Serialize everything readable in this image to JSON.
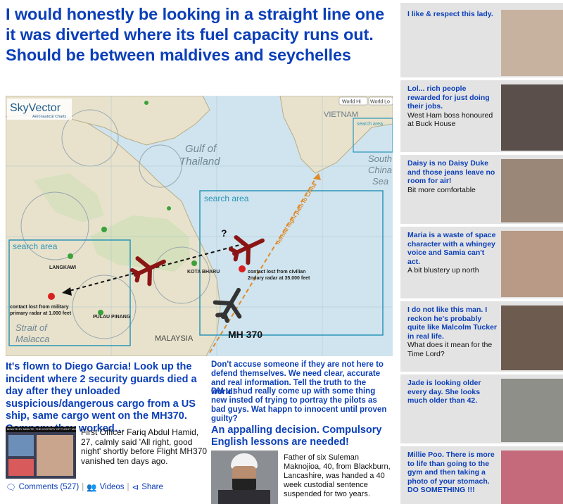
{
  "headline": "I would honestly be looking in a straight line one it was diverted where its fuel capacity runs out. Should be between maldives and seychelles",
  "map": {
    "brand": "SkyVector",
    "brand_sub": "Aeronautical Charts",
    "btn_world_hi": "World Hi",
    "btn_world_lo": "World Lo",
    "label_vietnam": "VIETNAM",
    "label_gulf": "Gulf of",
    "label_thailand": "Thailand",
    "label_south": "South",
    "label_china": "China",
    "label_sea": "Sea",
    "label_search_area_small": "search area",
    "label_search_area_big": "search area",
    "label_search_area_left": "search area",
    "label_langkawi": "LANGKAWI",
    "label_kota_bharu": "KOTA BHARU",
    "label_pulau_pinang": "PULAU PINANG",
    "label_malaysia": "MALAYSIA",
    "label_strait": "Strait of",
    "label_malacca": "Malacca",
    "label_mh370": "MH 370",
    "label_normal_path": "normal flight path to China",
    "label_contact_civil_1": "contact lost from civilian",
    "label_contact_civil_2": "2ndary radar at 35.000 feet",
    "label_contact_mil_1": "contact lost from military",
    "label_contact_mil_2": "primary radar at 1.000 feet",
    "label_question": "?"
  },
  "col1": {
    "headline": "It's flown to Diego Garcia! Look up the incident where 2 security guards died a day after they unloaded suspicious/dangerous cargo from a US ship, same cargo went on the MH370. Company they worked…",
    "text": "First Officer Fariq Abdul Hamid, 27, calmly said 'All right, good night' shortly before Flight MH370 vanished ten days ago.",
    "thumb_caption": "MINUTE BY MINUTE, THE MYSTERY OF FLIGHT MH370"
  },
  "social": {
    "comments": "Comments (527)",
    "videos": "Videos",
    "share": "Share"
  },
  "col2": {
    "comment_a": "Don't accuse someone if they are not here to defend themselves. We need clear, accurate and real information. Tell the truth to the world!",
    "comment_b": "DM u shud really come up with some thing new insted of trying to portray the pilots as bad guys. Wat happn to innocent until proven guilty?",
    "headline": "An appalling decision. Compulsory English lessons are needed!",
    "text": "Father of six Suleman Maknojioa, 40, from Blackburn, Lancashire, was handed a 40 week custodial sentence suspended for two years."
  },
  "sidebar": {
    "items": [
      {
        "quote": "I like & respect this lady.",
        "sub": ""
      },
      {
        "quote": "Lol... rich people rewarded for just doing their jobs.",
        "sub": "West Ham boss honoured at Buck House"
      },
      {
        "quote": "Daisy is no Daisy Duke and those jeans leave no room for air!",
        "sub": "Bit more comfortable"
      },
      {
        "quote": "Maria is a waste of space character with a whingey voice and Samia can't act.",
        "sub": "A bit blustery up north"
      },
      {
        "quote": "I do not like this man. I reckon he's probably quite like Malcolm Tucker in real life.",
        "sub": "What does it mean for the Time Lord?"
      },
      {
        "quote": "Jade is looking older every day. She looks much older than 42.",
        "sub": ""
      },
      {
        "quote": "Millie Poo. There is more to life than going to the gym and then taking a photo of your stomach. DO SOMETHING !!!",
        "sub": ""
      }
    ]
  },
  "colors": {
    "accent_blue": "#0b3fb9",
    "sidebar_bg": "#e3e3e3"
  }
}
